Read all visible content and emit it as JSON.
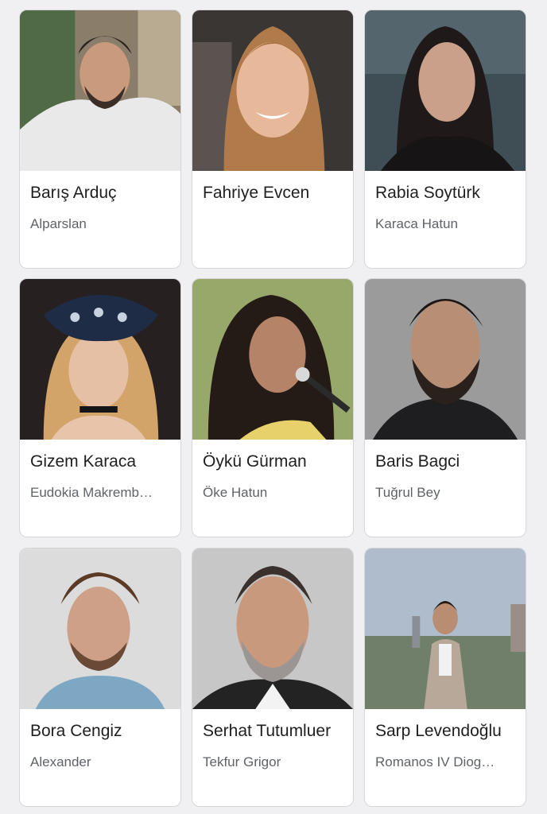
{
  "cast": [
    {
      "name": "Barış Arduç",
      "role": "Alparslan"
    },
    {
      "name": "Fahriye Evcen",
      "role": ""
    },
    {
      "name": "Rabia Soytürk",
      "role": "Karaca Hatun"
    },
    {
      "name": "Gizem Karaca",
      "role": "Eudokia Makremb…"
    },
    {
      "name": "Öykü Gürman",
      "role": "Öke Hatun"
    },
    {
      "name": "Baris Bagci",
      "role": "Tuğrul Bey"
    },
    {
      "name": "Bora Cengiz",
      "role": "Alexander"
    },
    {
      "name": "Serhat Tutumluer",
      "role": "Tekfur Grigor"
    },
    {
      "name": "Sarp Levendoğlu",
      "role": "Romanos IV Diog…"
    }
  ],
  "colors": {
    "page_background": "#f0f0f2",
    "card_border": "#d6d6d9",
    "name_text": "#1f1f1f",
    "role_text": "#5f6368"
  }
}
